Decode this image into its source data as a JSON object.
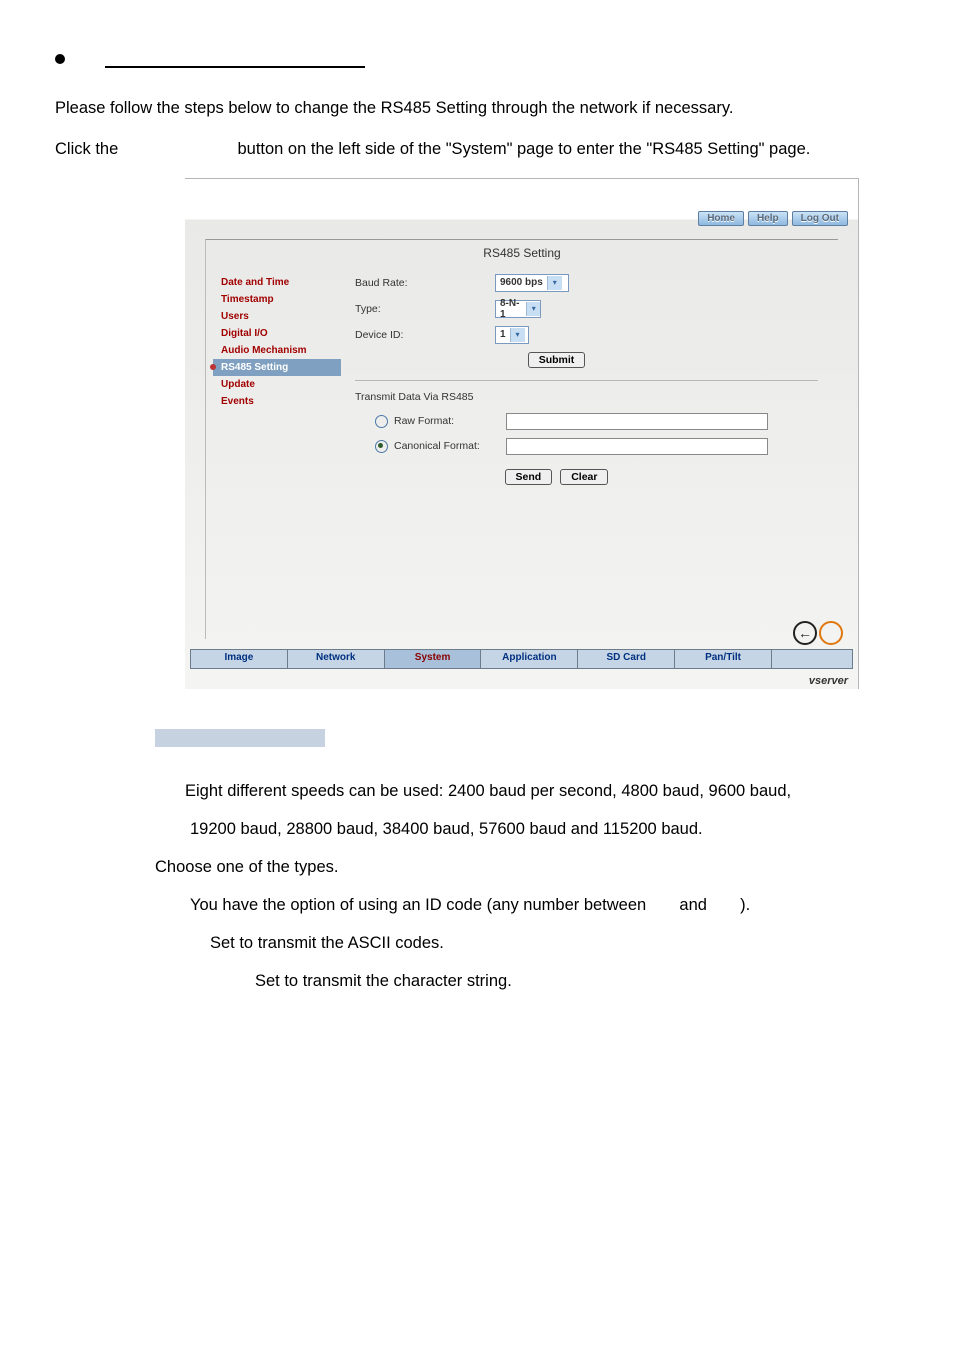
{
  "intro": {
    "line1": "Please follow the steps below to change the RS485 Setting through the network if necessary.",
    "line2_a": "Click the",
    "line2_b": "button on the left side of the \"System\" page to enter the \"RS485 Setting\" page."
  },
  "topbar": {
    "home": "Home",
    "help": "Help",
    "logout": "Log Out"
  },
  "panel_title": "RS485 Setting",
  "sidebar": {
    "items": [
      "Date and Time",
      "Timestamp",
      "Users",
      "Digital I/O",
      "Audio Mechanism",
      "RS485 Setting",
      "Update",
      "Events"
    ]
  },
  "form": {
    "baud_label": "Baud Rate:",
    "baud_value": "9600 bps",
    "type_label": "Type:",
    "type_value": "8-N-1",
    "device_label": "Device ID:",
    "device_value": "1",
    "submit": "Submit",
    "transmit_heading": "Transmit Data Via RS485",
    "raw_label": "Raw Format:",
    "canon_label": "Canonical Format:",
    "send": "Send",
    "clear": "Clear"
  },
  "tabs": [
    "Image",
    "Network",
    "System",
    "Application",
    "SD Card",
    "Pan/Tilt"
  ],
  "brand": "vserver",
  "desc": {
    "baud_a": "Eight different speeds can be used: 2400 baud per second, 4800 baud, 9600 baud,",
    "baud_b": "19200 baud, 28800 baud, 38400 baud, 57600 baud and 115200 baud.",
    "type": "Choose one of the types.",
    "id_a": "You have the option of using an ID code (any number between",
    "id_b": "and",
    "id_c": ").",
    "raw": "Set to transmit the ASCII codes.",
    "canon": "Set to transmit the character string."
  }
}
